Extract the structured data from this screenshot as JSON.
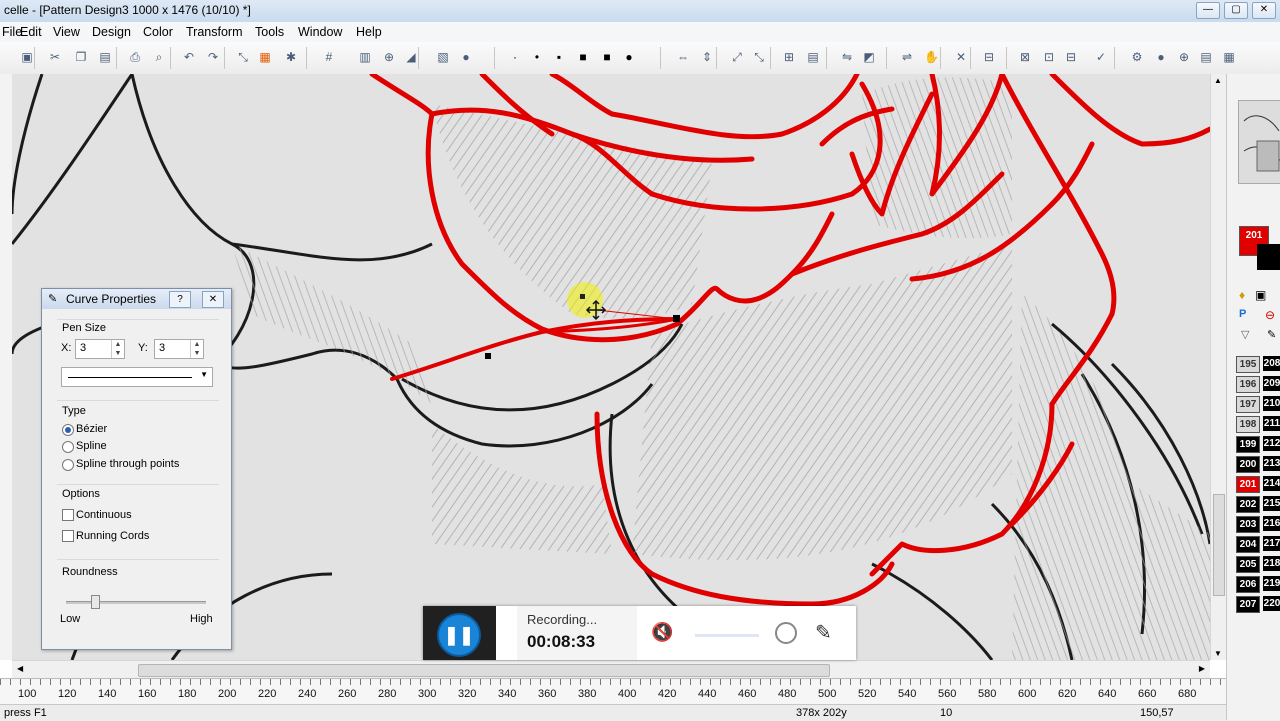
{
  "window": {
    "title": "celle - [Pattern Design3 1000 x 1476 (10/10) *]",
    "buttons": [
      "—",
      "▢",
      "✕"
    ]
  },
  "menu": [
    "File",
    "Edit",
    "View",
    "Design",
    "Color",
    "Transform",
    "Tools",
    "Window",
    "Help"
  ],
  "toolbar": {
    "icons": [
      "save-icon",
      "cut-icon",
      "copy-icon",
      "paste-icon",
      "print-icon",
      "preview-icon",
      "undo-icon",
      "redo-icon",
      "transform-icon",
      "pattern-icon",
      "magic-icon",
      "grid-icon",
      "align-icon",
      "zoom-icon",
      "measure-icon",
      "stamp-icon",
      "brush-icon",
      "pen-dot-1-icon",
      "pen-dot-2-icon",
      "pen-dot-3-icon",
      "pen-square-icon",
      "pen-square-large-icon",
      "pen-circle-icon",
      "flip-h-icon",
      "flip-v-icon",
      "rotate-icon",
      "skew-icon",
      "layer-icon",
      "mirror-icon",
      "fill-icon",
      "bucket-icon",
      "delete-icon",
      "merge-icon",
      "settings-icon",
      "color-icon",
      "magic-wand-icon",
      "globe-icon",
      "layers-icon",
      "stats-icon"
    ]
  },
  "dialog": {
    "title": "Curve Properties",
    "help": "?",
    "close": "✕",
    "pen_size_label": "Pen Size",
    "x_label": "X:",
    "x_value": "3",
    "y_label": "Y:",
    "y_value": "3",
    "type_label": "Type",
    "types": [
      "Bézier",
      "Spline",
      "Spline through points"
    ],
    "selected_type": "Bézier",
    "options_label": "Options",
    "continuous_label": "Continuous",
    "running_cords_label": "Running Cords",
    "roundness_label": "Roundness",
    "low_label": "Low",
    "high_label": "High",
    "roundness_value": 0.2
  },
  "recorder": {
    "status": "Recording...",
    "time": "00:08:33"
  },
  "ruler": [
    "100",
    "120",
    "140",
    "160",
    "180",
    "200",
    "220",
    "240",
    "260",
    "280",
    "300",
    "320",
    "340",
    "360",
    "380",
    "400",
    "420",
    "440",
    "460",
    "480",
    "500",
    "520",
    "540",
    "560",
    "580",
    "600",
    "620",
    "640",
    "660",
    "680"
  ],
  "color_panel": {
    "current": "201",
    "swatches_a": [
      "195",
      "196",
      "197",
      "198",
      "199",
      "200",
      "201",
      "202",
      "203",
      "204",
      "205",
      "206",
      "207"
    ],
    "swatches_b": [
      "208",
      "209",
      "210",
      "211",
      "212",
      "213",
      "214",
      "215",
      "216",
      "217",
      "218",
      "219",
      "220"
    ],
    "selected": "201",
    "accent": "#e00000"
  },
  "status": {
    "left": "press F1",
    "coords": "378x 202y",
    "zoom": "10",
    "right": "150,57"
  }
}
